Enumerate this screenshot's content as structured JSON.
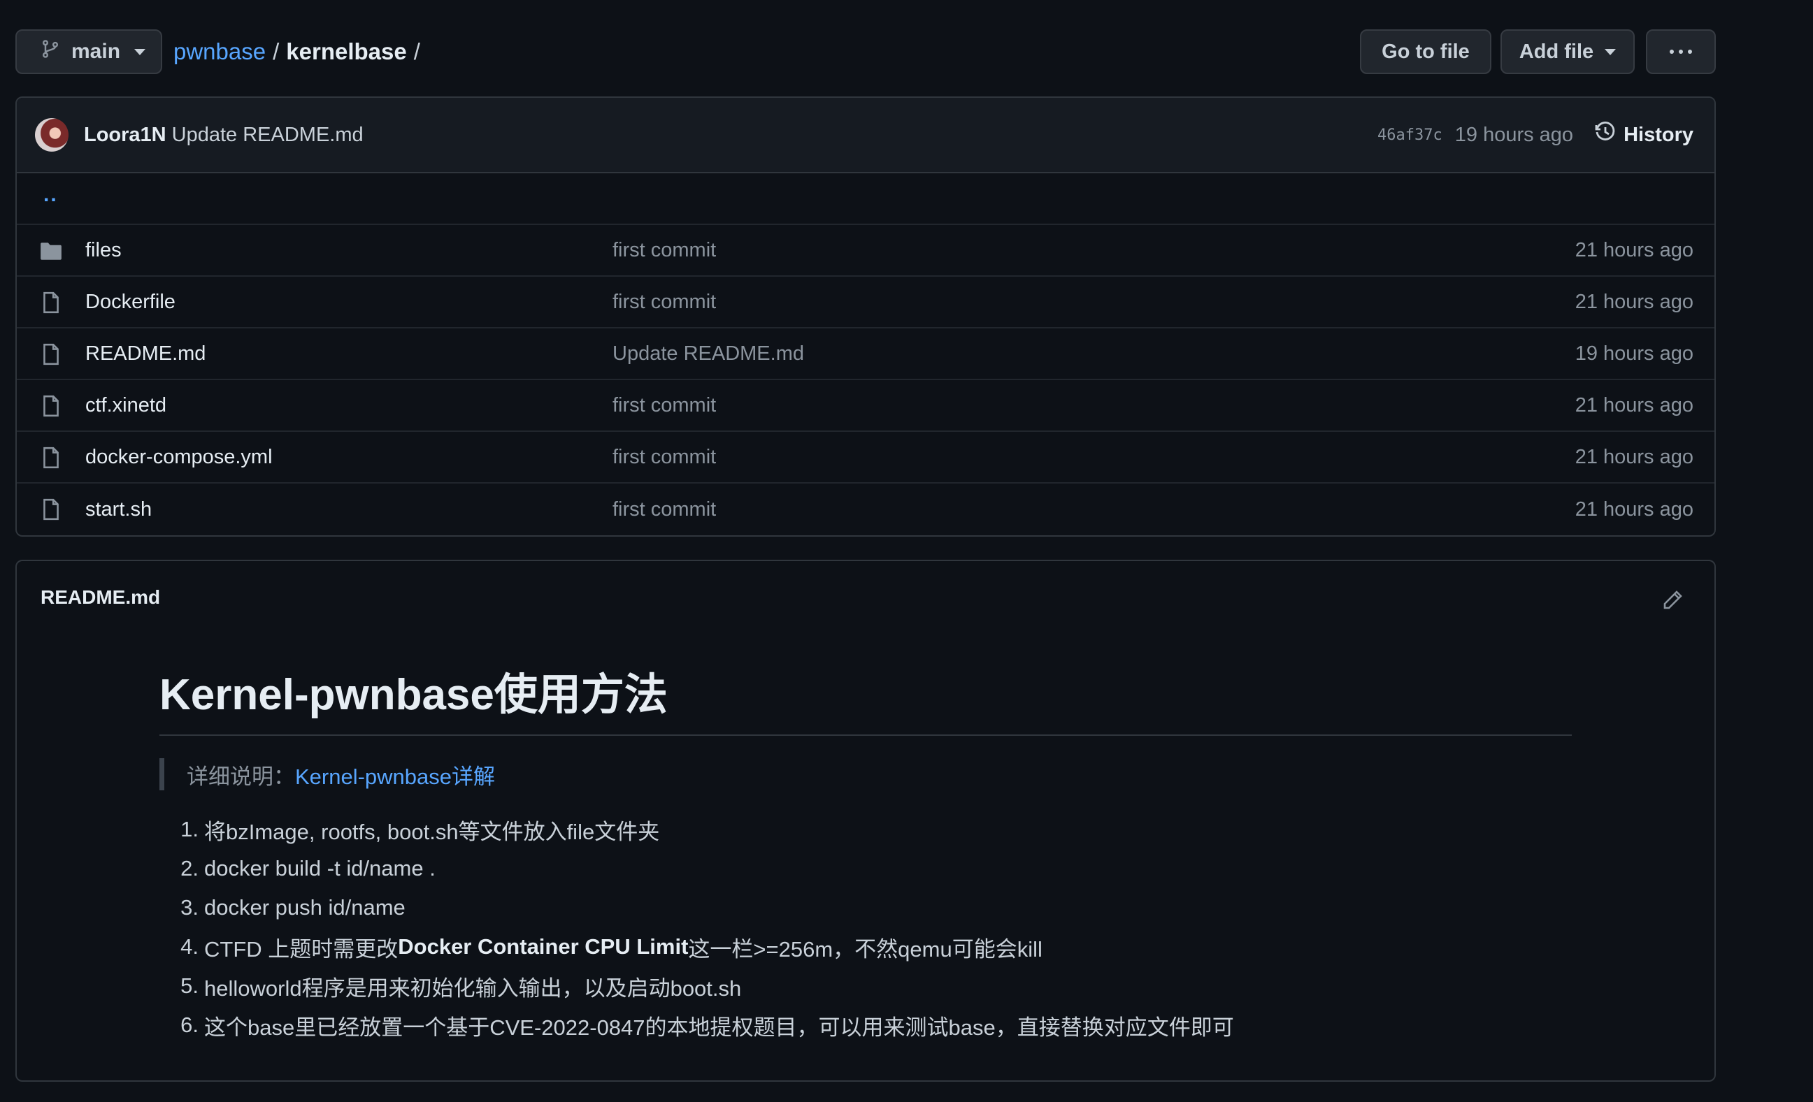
{
  "topbar": {
    "branch": "main",
    "repo": "pwnbase",
    "sep1": "/",
    "folder": "kernelbase",
    "sep2": "/",
    "go_to_file": "Go to file",
    "add_file": "Add file"
  },
  "commit": {
    "author": "Loora1N",
    "message": "Update README.md",
    "sha": "46af37c",
    "time": "19 hours ago",
    "history": "History"
  },
  "up_dir": "..",
  "files": [
    {
      "name": "files",
      "type": "folder",
      "message": "first commit",
      "time": "21 hours ago"
    },
    {
      "name": "Dockerfile",
      "type": "file",
      "message": "first commit",
      "time": "21 hours ago"
    },
    {
      "name": "README.md",
      "type": "file",
      "message": "Update README.md",
      "time": "19 hours ago"
    },
    {
      "name": "ctf.xinetd",
      "type": "file",
      "message": "first commit",
      "time": "21 hours ago"
    },
    {
      "name": "docker-compose.yml",
      "type": "file",
      "message": "first commit",
      "time": "21 hours ago"
    },
    {
      "name": "start.sh",
      "type": "file",
      "message": "first commit",
      "time": "21 hours ago"
    }
  ],
  "readme": {
    "filename": "README.md",
    "heading": "Kernel-pwnbase使用方法",
    "quote_prefix": "详细说明：",
    "quote_link": "Kernel-pwnbase详解",
    "steps": [
      {
        "num": "1.",
        "text": "将bzImage, rootfs, boot.sh等文件放入file文件夹"
      },
      {
        "num": "2.",
        "text": "docker build -t id/name ."
      },
      {
        "num": "3.",
        "text": "docker push id/name"
      },
      {
        "num": "4.",
        "pre": "CTFD 上题时需更改",
        "bold": "Docker Container CPU Limit",
        "post": "这一栏>=256m，不然qemu可能会kill"
      },
      {
        "num": "5.",
        "text": "helloworld程序是用来初始化输入输出，以及启动boot.sh"
      },
      {
        "num": "6.",
        "text": "这个base里已经放置一个基于CVE-2022-0847的本地提权题目，可以用来测试base，直接替换对应文件即可"
      }
    ]
  },
  "icons": {
    "branch": "git-branch-icon",
    "folder": "folder-icon",
    "file": "file-icon",
    "history": "history-clock-icon",
    "edit": "pencil-icon",
    "more": "kebab-horizontal-icon"
  },
  "colors": {
    "background": "#0d1117",
    "link": "#58a6ff",
    "muted": "#8b949e",
    "border": "#30363d"
  }
}
